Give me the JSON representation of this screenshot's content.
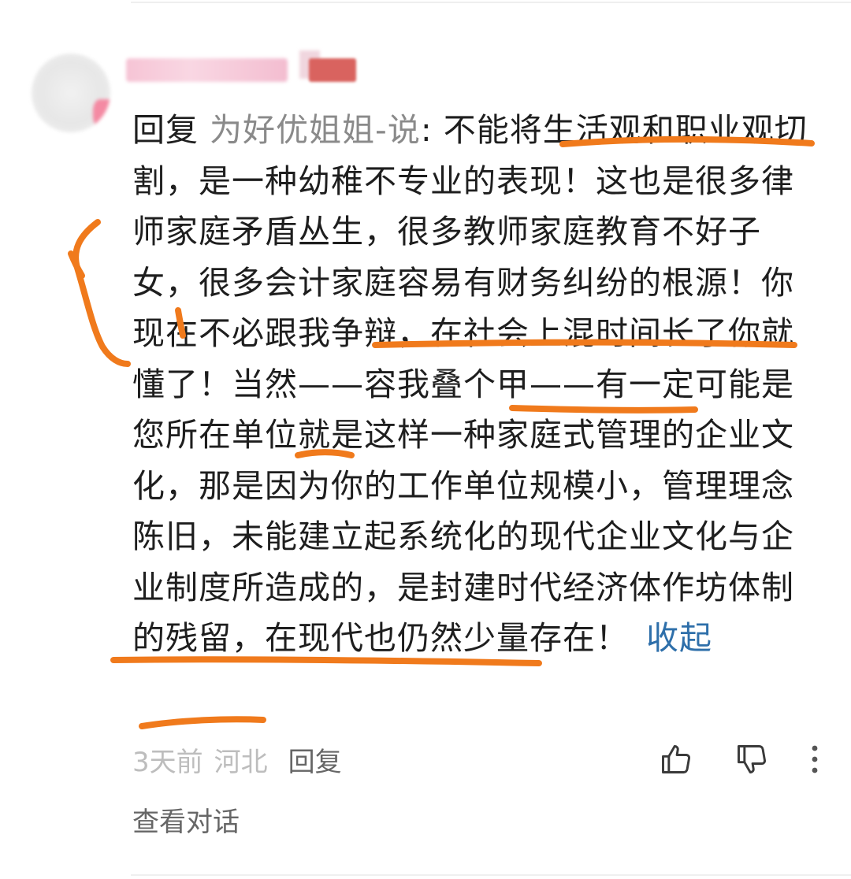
{
  "comment": {
    "reply_prefix": "回复",
    "reply_target": "为好优姐姐-说",
    "reply_colon": ": ",
    "body": "不能将生活观和职业观切割，是一种幼稚不专业的表现！这也是很多律师家庭矛盾丛生，很多教师家庭教育不好子女，很多会计家庭容易有财务纠纷的根源！你现在不必跟我争辩，在社会上混时间长了你就懂了！当然——容我叠个甲——有一定可能是您所在单位就是这样一种家庭式管理的企业文化，那是因为你的工作单位规模小，管理理念陈旧，未能建立起系统化的现代企业文化与企业制度所造成的，是封建时代经济体作坊体制的残留，在现代也仍然少量存在！",
    "collapse_label": "收起"
  },
  "meta": {
    "time": "3天前",
    "location": "河北",
    "reply_label": "回复"
  },
  "footer": {
    "view_conversation": "查看对话"
  },
  "icons": [
    "thumbs-up-icon",
    "thumbs-down-icon",
    "more-vertical-icon"
  ],
  "colors": {
    "text": "#1e1e1e",
    "reply_target": "#8a8a8a",
    "link": "#2e6faa",
    "meta": "#bdbdbd",
    "annotation": "#f07a1c"
  }
}
